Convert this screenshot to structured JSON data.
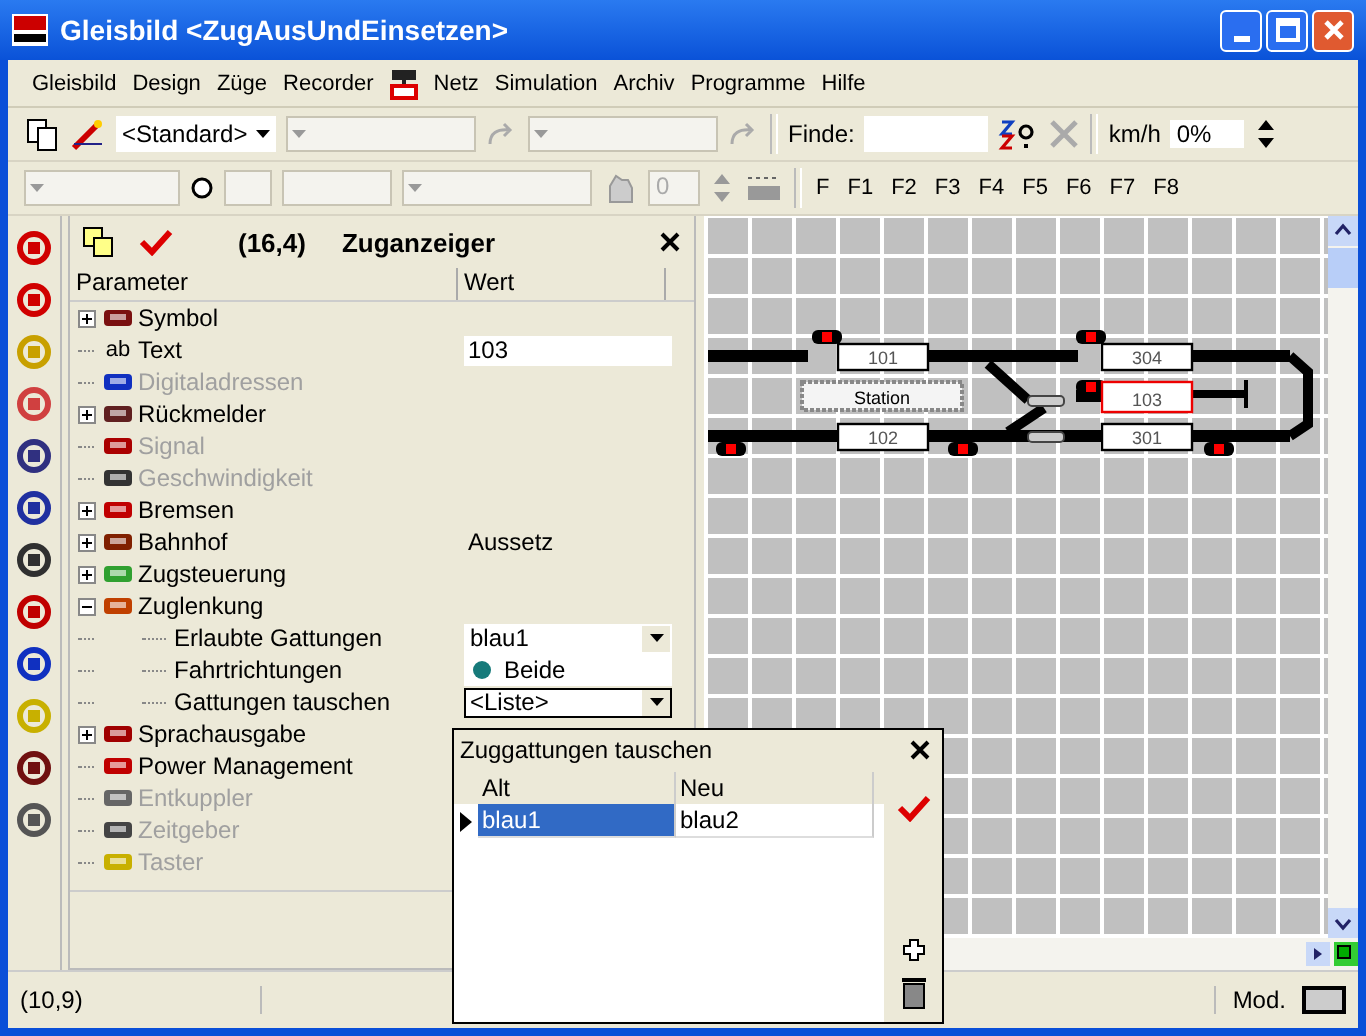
{
  "window": {
    "title": "Gleisbild <ZugAusUndEinsetzen>"
  },
  "menu": [
    {
      "kind": "text",
      "label": "Gleisbild"
    },
    {
      "kind": "text",
      "label": "Design"
    },
    {
      "kind": "text",
      "label": "Züge"
    },
    {
      "kind": "text",
      "label": "Recorder"
    },
    {
      "kind": "icon"
    },
    {
      "kind": "text",
      "label": "Netz"
    },
    {
      "kind": "text",
      "label": "Simulation"
    },
    {
      "kind": "text",
      "label": "Archiv"
    },
    {
      "kind": "text",
      "label": "Programme"
    },
    {
      "kind": "text",
      "label": "Hilfe"
    }
  ],
  "toolbar": {
    "style_combo": "<Standard>",
    "find_label": "Finde:",
    "speed_unit": "km/h",
    "speed_value": "0%",
    "number_field": "0",
    "function_keys": [
      "F",
      "F1",
      "F2",
      "F3",
      "F4",
      "F5",
      "F6",
      "F7",
      "F8"
    ]
  },
  "properties": {
    "coords": "(16,4)",
    "title": "Zuganzeiger",
    "columns": [
      "Parameter",
      "Wert"
    ],
    "rows": [
      {
        "label": "Symbol",
        "expanded": false,
        "disabled": false
      },
      {
        "label": "Text",
        "icon_text": "ab",
        "disabled": false,
        "value": {
          "kind": "input",
          "text": "103"
        }
      },
      {
        "label": "Digitaladressen",
        "disabled": true
      },
      {
        "label": "Rückmelder",
        "expanded": false,
        "disabled": false
      },
      {
        "label": "Signal",
        "disabled": true
      },
      {
        "label": "Geschwindigkeit",
        "disabled": true
      },
      {
        "label": "Bremsen",
        "expanded": false,
        "disabled": false
      },
      {
        "label": "Bahnhof",
        "expanded": false,
        "disabled": false,
        "value": {
          "kind": "text",
          "text": "Aussetz"
        }
      },
      {
        "label": "Zugsteuerung",
        "expanded": false,
        "disabled": false
      },
      {
        "label": "Zuglenkung",
        "expanded": true,
        "disabled": false,
        "children": [
          {
            "label": "Erlaubte Gattungen",
            "disabled": false,
            "value": {
              "kind": "dropdown",
              "text": "blau1",
              "focused": false
            }
          },
          {
            "label": "Fahrtrichtungen",
            "disabled": false,
            "value": {
              "kind": "radio",
              "text": "Beide"
            }
          },
          {
            "label": "Gattungen tauschen",
            "disabled": false,
            "value": {
              "kind": "dropdown",
              "text": "<Liste>",
              "focused": true
            }
          }
        ]
      },
      {
        "label": "Sprachausgabe",
        "expanded": false,
        "disabled": false
      },
      {
        "label": "Power Management",
        "disabled": false
      },
      {
        "label": "Entkuppler",
        "disabled": true
      },
      {
        "label": "Zeitgeber",
        "disabled": true
      },
      {
        "label": "Taster",
        "disabled": true
      }
    ]
  },
  "track": {
    "labels": [
      {
        "text": "101",
        "kind": "block",
        "selected": false
      },
      {
        "text": "304",
        "kind": "block",
        "selected": false
      },
      {
        "text": "Station",
        "kind": "station",
        "selected": false
      },
      {
        "text": "103",
        "kind": "block",
        "selected": true
      },
      {
        "text": "102",
        "kind": "block",
        "selected": false
      },
      {
        "text": "301",
        "kind": "block",
        "selected": false
      }
    ]
  },
  "dialog": {
    "title": "Zuggattungen tauschen",
    "columns": [
      "Alt",
      "Neu"
    ],
    "rows": [
      {
        "old": "blau1",
        "new": "blau2",
        "selected": true
      }
    ]
  },
  "status_bar": {
    "position": "(10,9)",
    "mode": "Mod."
  }
}
